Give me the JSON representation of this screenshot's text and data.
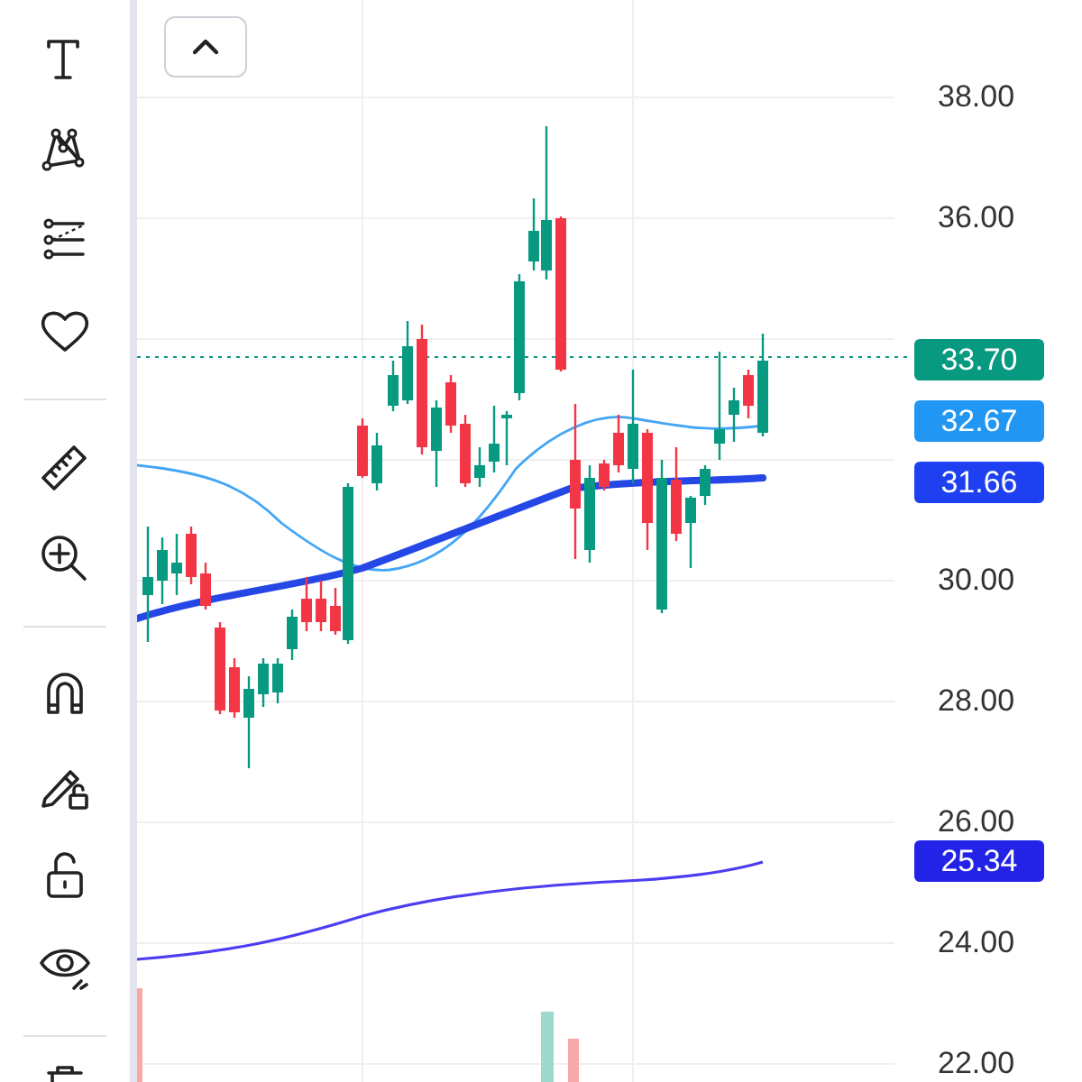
{
  "price_axis": {
    "labels": [
      "38.00",
      "36.00",
      "30.00",
      "28.00",
      "26.00",
      "24.00",
      "22.00"
    ]
  },
  "price_badges": [
    {
      "value": "33.70",
      "color": "#089981"
    },
    {
      "value": "32.67",
      "color": "#2196f3"
    },
    {
      "value": "31.66",
      "color": "#1e40f0"
    },
    {
      "value": "25.34",
      "color": "#2323e8"
    }
  ]
}
